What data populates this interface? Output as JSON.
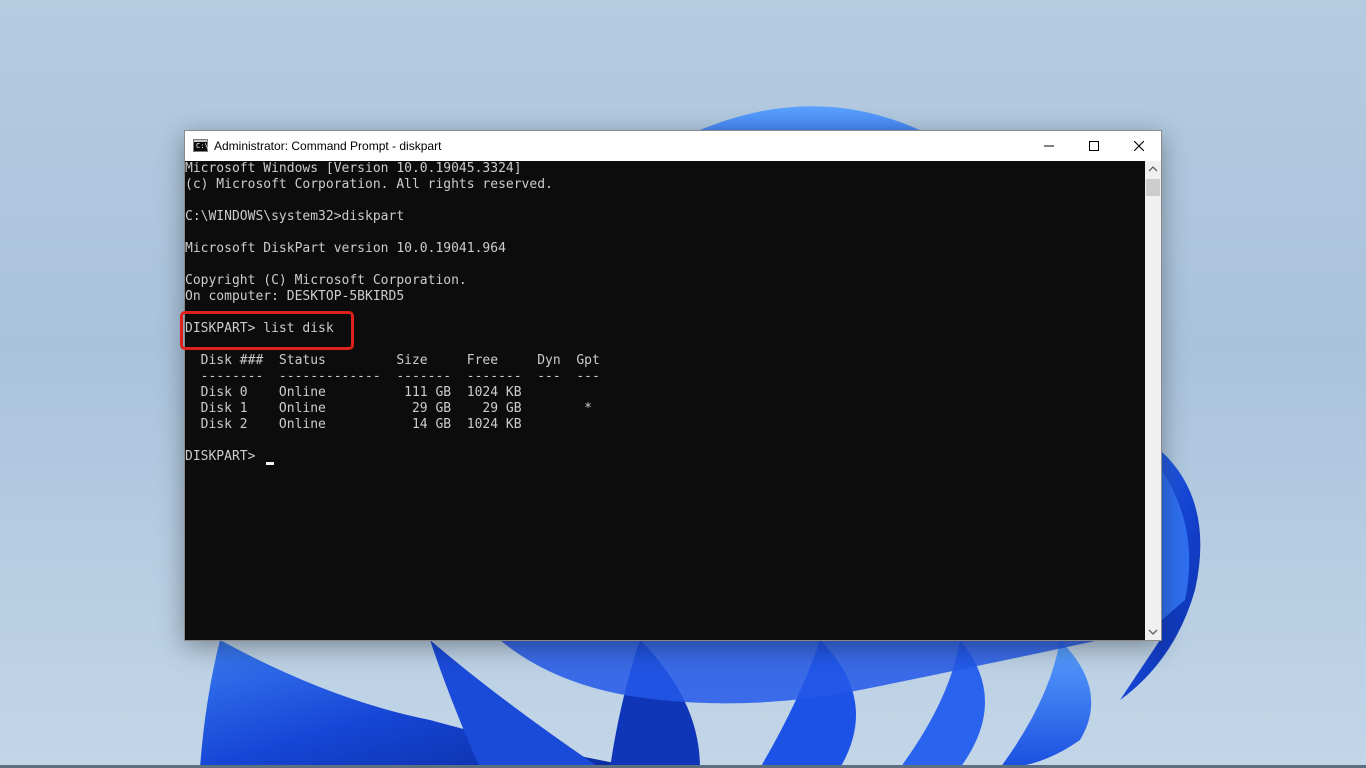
{
  "window": {
    "title": "Administrator: Command Prompt - diskpart",
    "icon_label": "C:\\",
    "icon": "cmd-icon",
    "buttons": {
      "minimize": "minimize-icon",
      "maximize": "maximize-icon",
      "close": "close-icon"
    }
  },
  "console": {
    "lines": [
      "Microsoft Windows [Version 10.0.19045.3324]",
      "(c) Microsoft Corporation. All rights reserved.",
      "",
      "C:\\WINDOWS\\system32>diskpart",
      "",
      "Microsoft DiskPart version 10.0.19041.964",
      "",
      "Copyright (C) Microsoft Corporation.",
      "On computer: DESKTOP-5BKIRD5",
      "",
      "DISKPART> list disk",
      "",
      "  Disk ###  Status         Size     Free     Dyn  Gpt",
      "  --------  -------------  -------  -------  ---  ---",
      "  Disk 0    Online          111 GB  1024 KB",
      "  Disk 1    Online           29 GB    29 GB        *",
      "  Disk 2    Online           14 GB  1024 KB",
      "",
      "DISKPART> "
    ]
  },
  "colors": {
    "console_bg": "#0c0c0c",
    "console_text": "#cccccc",
    "highlight": "#e0201c"
  }
}
